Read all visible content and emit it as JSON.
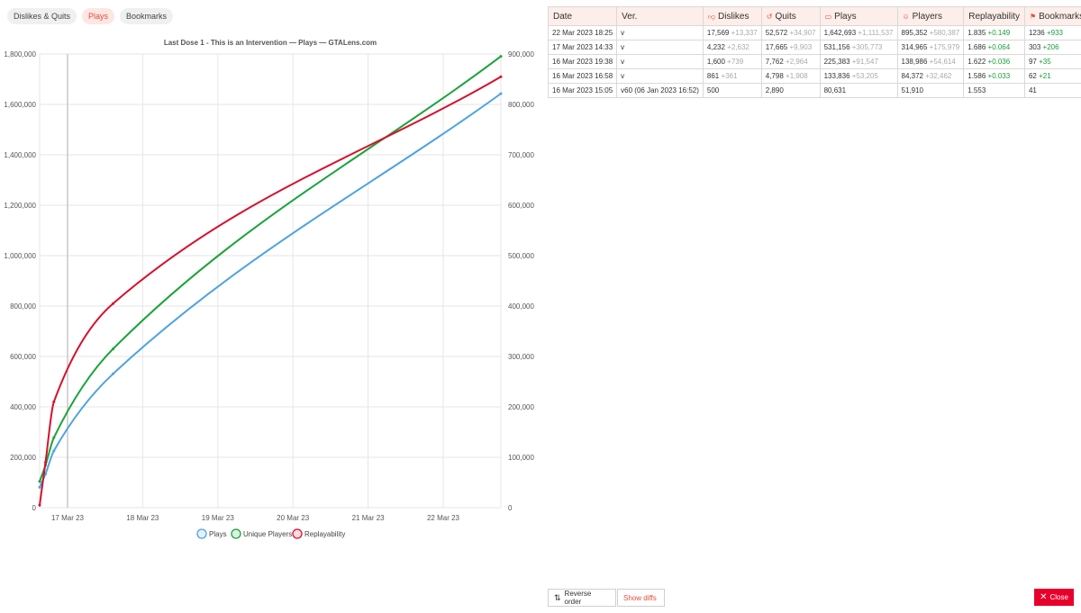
{
  "tabs": [
    {
      "label": "Dislikes & Quits",
      "active": false
    },
    {
      "label": "Plays",
      "active": true
    },
    {
      "label": "Bookmarks",
      "active": false
    }
  ],
  "chart_data": {
    "type": "line",
    "title": "Last Dose 1 - This is an Intervention — Plays — GTALens.com",
    "x_ticks": [
      "17 Mar 23",
      "18 Mar 23",
      "19 Mar 23",
      "20 Mar 23",
      "21 Mar 23",
      "22 Mar 23"
    ],
    "x_range": [
      "16 Mar 2023 15:05",
      "22 Mar 2023 18:25"
    ],
    "y_left_ticks": [
      "0",
      "200,000",
      "400,000",
      "600,000",
      "800,000",
      "1,000,000",
      "1,200,000",
      "1,400,000",
      "1,600,000",
      "1,800,000"
    ],
    "y_left_range": [
      0,
      1800000
    ],
    "y_right_ticks": [
      "0",
      "100,000",
      "200,000",
      "300,000",
      "400,000",
      "500,000",
      "600,000",
      "700,000",
      "800,000",
      "900,000"
    ],
    "y_right_range": [
      0,
      900000
    ],
    "grid": true,
    "legend_position": "bottom",
    "series": [
      {
        "name": "Plays",
        "axis": "left",
        "color": "#4da3e0",
        "points": [
          [
            "16 Mar 2023 15:05",
            80631
          ],
          [
            "16 Mar 2023 16:58",
            133836
          ],
          [
            "16 Mar 2023 19:38",
            225383
          ],
          [
            "17 Mar 2023 14:33",
            531156
          ],
          [
            "22 Mar 2023 18:25",
            1642693
          ]
        ]
      },
      {
        "name": "Unique Players",
        "axis": "right",
        "color": "#1aa33a",
        "points": [
          [
            "16 Mar 2023 15:05",
            51910
          ],
          [
            "16 Mar 2023 16:58",
            84372
          ],
          [
            "16 Mar 2023 19:38",
            138986
          ],
          [
            "17 Mar 2023 14:33",
            314965
          ],
          [
            "22 Mar 2023 18:25",
            895352
          ]
        ]
      },
      {
        "name": "Replayability",
        "axis": "left",
        "color": "#d8102c",
        "points": [
          [
            "16 Mar 2023 15:05",
            10000
          ],
          [
            "16 Mar 2023 16:58",
            180000
          ],
          [
            "16 Mar 2023 19:38",
            420000
          ],
          [
            "17 Mar 2023 14:33",
            810000
          ],
          [
            "22 Mar 2023 18:25",
            1710000
          ]
        ]
      }
    ]
  },
  "table": {
    "headers": [
      {
        "label": "Date",
        "icon": ""
      },
      {
        "label": "Ver.",
        "icon": ""
      },
      {
        "label": "Dislikes",
        "icon": "thumbs-down-icon"
      },
      {
        "label": "Quits",
        "icon": "quit-icon"
      },
      {
        "label": "Plays",
        "icon": "gamepad-icon"
      },
      {
        "label": "Players",
        "icon": "person-icon"
      },
      {
        "label": "Replayability",
        "icon": ""
      },
      {
        "label": "Bookmarks",
        "icon": "bookmark-icon"
      }
    ],
    "rows": [
      {
        "date": "22 Mar 2023 18:25",
        "ver": "v",
        "dislikes": "17,569",
        "dislikes_d": "+13,337",
        "quits": "52,572",
        "quits_d": "+34,907",
        "plays": "1,642,693",
        "plays_d": "+1,111,537",
        "players": "895,352",
        "players_d": "+580,387",
        "replay": "1.835",
        "replay_d": "+0.149",
        "bookmarks": "1236",
        "bookmarks_d": "+933"
      },
      {
        "date": "17 Mar 2023 14:33",
        "ver": "v",
        "dislikes": "4,232",
        "dislikes_d": "+2,632",
        "quits": "17,665",
        "quits_d": "+9,903",
        "plays": "531,156",
        "plays_d": "+305,773",
        "players": "314,965",
        "players_d": "+175,979",
        "replay": "1.686",
        "replay_d": "+0.064",
        "bookmarks": "303",
        "bookmarks_d": "+206"
      },
      {
        "date": "16 Mar 2023 19:38",
        "ver": "v",
        "dislikes": "1,600",
        "dislikes_d": "+739",
        "quits": "7,762",
        "quits_d": "+2,964",
        "plays": "225,383",
        "plays_d": "+91,547",
        "players": "138,986",
        "players_d": "+54,614",
        "replay": "1.622",
        "replay_d": "+0.036",
        "bookmarks": "97",
        "bookmarks_d": "+35"
      },
      {
        "date": "16 Mar 2023 16:58",
        "ver": "v",
        "dislikes": "861",
        "dislikes_d": "+361",
        "quits": "4,798",
        "quits_d": "+1,908",
        "plays": "133,836",
        "plays_d": "+53,205",
        "players": "84,372",
        "players_d": "+32,462",
        "replay": "1.586",
        "replay_d": "+0.033",
        "bookmarks": "62",
        "bookmarks_d": "+21"
      },
      {
        "date": "16 Mar 2023 15:05",
        "ver": "v60 (06 Jan 2023 16:52)",
        "dislikes": "500",
        "dislikes_d": "",
        "quits": "2,890",
        "quits_d": "",
        "plays": "80,631",
        "plays_d": "",
        "players": "51,910",
        "players_d": "",
        "replay": "1.553",
        "replay_d": "",
        "bookmarks": "41",
        "bookmarks_d": ""
      }
    ]
  },
  "buttons": {
    "reverse": "Reverse order",
    "diffs": "Show diffs",
    "close": "Close"
  },
  "colors": {
    "accent": "#e84a3c",
    "close_bg": "#e8002c",
    "header_bg": "#fdeee9",
    "delta_green": "#1a9e3a",
    "delta_gray": "#aaaaaa"
  }
}
